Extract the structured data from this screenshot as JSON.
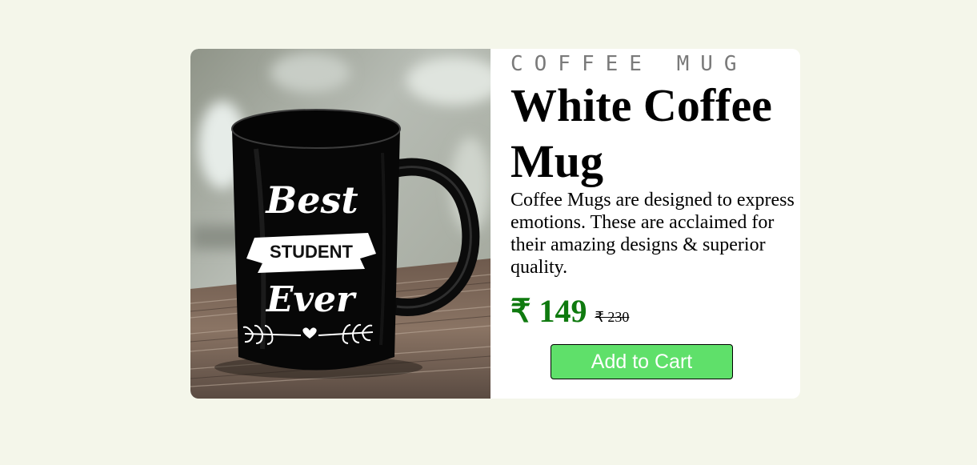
{
  "product": {
    "category": "COFFEE MUG",
    "title": "White Coffee Mug",
    "description": "Coffee Mugs are designed to express emotions. These are acclaimed for their amazing designs & superior quality.",
    "price": "₹ 149",
    "original_price": "₹ 230",
    "add_to_cart_label": "Add to Cart",
    "image": {
      "icon": "coffee-mug-photo",
      "mug_text": {
        "line1": "Best",
        "line2": "STUDENT",
        "line3": "Ever"
      }
    }
  },
  "colors": {
    "page_background": "#f4f6ea",
    "card_background": "#ffffff",
    "price": "#0f7a0f",
    "button_background": "#5fe06a",
    "button_text": "#ffffff",
    "category_text": "#7a7a7a"
  }
}
